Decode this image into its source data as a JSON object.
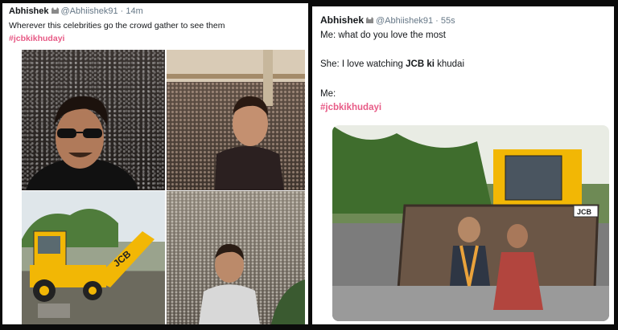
{
  "left_tweet": {
    "author_name": "Abhishek",
    "handle": "@Abhiishek91",
    "time": "14m",
    "text": "Wherever this celebrities go the crowd gather to see them",
    "hashtag": "#jcbkikhudayi"
  },
  "right_tweet": {
    "author_name": "Abhishek",
    "handle": "@Abhiishek91",
    "time": "55s",
    "line1": "Me: what do you love the most",
    "line2_prefix": "She: I love watching ",
    "line2_bold": "JCB ki",
    "line2_suffix": " khudai",
    "line3": "Me:",
    "hashtag": "#jcbkikhudayi"
  },
  "right_photo": {
    "plate_text": "JCB"
  },
  "left_photo": {
    "excavator_logo": "JCB"
  },
  "colors": {
    "hashtag": "#e0245e",
    "jcb_yellow": "#f2b705",
    "page_background": "#0b0b0b"
  }
}
